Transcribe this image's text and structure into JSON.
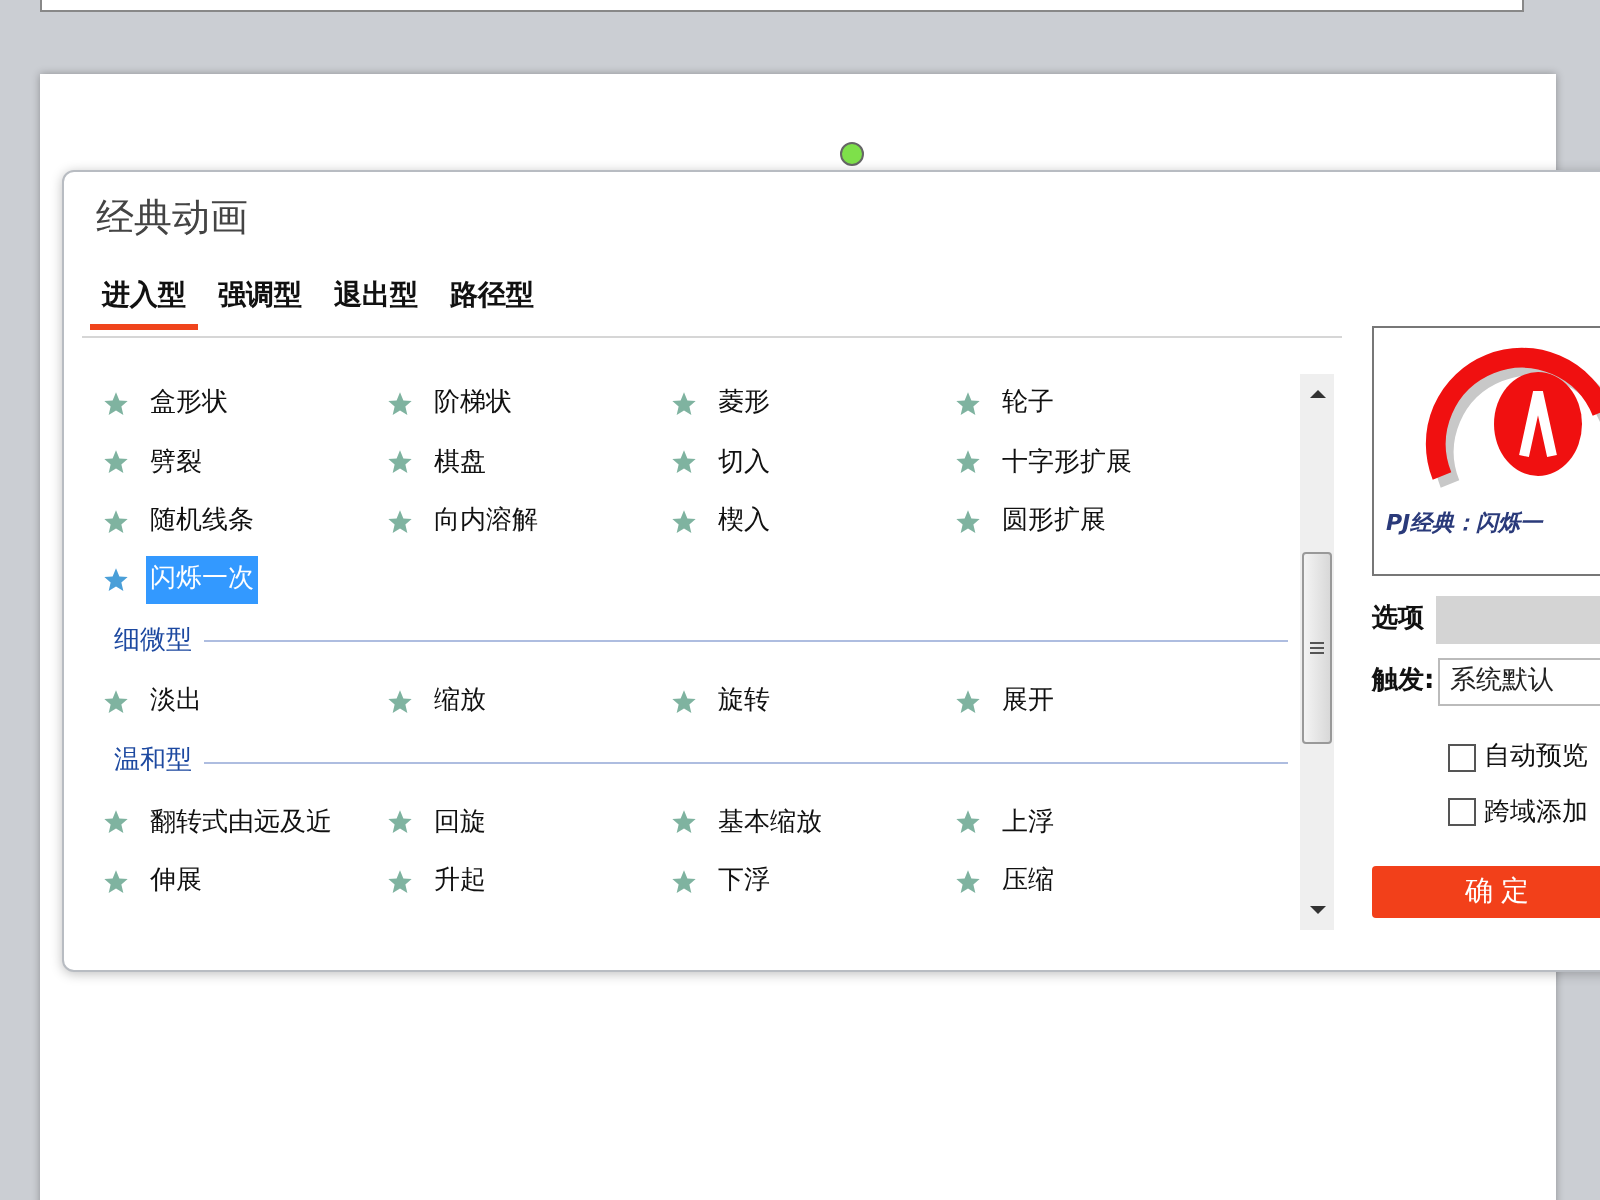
{
  "dialog": {
    "title": "经典动画",
    "tabs": [
      {
        "label": "进入型",
        "selected": true
      },
      {
        "label": "强调型",
        "selected": false
      },
      {
        "label": "退出型",
        "selected": false
      },
      {
        "label": "路径型",
        "selected": false
      }
    ],
    "sections": [
      {
        "items": [
          {
            "label": "盒形状",
            "selected": false
          },
          {
            "label": "阶梯状",
            "selected": false
          },
          {
            "label": "菱形",
            "selected": false
          },
          {
            "label": "轮子",
            "selected": false
          },
          {
            "label": "劈裂",
            "selected": false
          },
          {
            "label": "棋盘",
            "selected": false
          },
          {
            "label": "切入",
            "selected": false
          },
          {
            "label": "十字形扩展",
            "selected": false
          },
          {
            "label": "随机线条",
            "selected": false
          },
          {
            "label": "向内溶解",
            "selected": false
          },
          {
            "label": "楔入",
            "selected": false
          },
          {
            "label": "圆形扩展",
            "selected": false
          },
          {
            "label": "闪烁一次",
            "selected": true
          }
        ]
      },
      {
        "heading": "细微型",
        "items": [
          {
            "label": "淡出",
            "selected": false
          },
          {
            "label": "缩放",
            "selected": false
          },
          {
            "label": "旋转",
            "selected": false
          },
          {
            "label": "展开",
            "selected": false
          }
        ]
      },
      {
        "heading": "温和型",
        "items": [
          {
            "label": "翻转式由远及近",
            "selected": false
          },
          {
            "label": "回旋",
            "selected": false
          },
          {
            "label": "基本缩放",
            "selected": false
          },
          {
            "label": "上浮",
            "selected": false
          },
          {
            "label": "伸展",
            "selected": false
          },
          {
            "label": "升起",
            "selected": false
          },
          {
            "label": "下浮",
            "selected": false
          },
          {
            "label": "压缩",
            "selected": false
          }
        ]
      }
    ],
    "preview": {
      "caption": "PJ经典：闪烁一"
    },
    "options": {
      "label": "选项"
    },
    "trigger": {
      "label": "触发:",
      "value": "系统默认"
    },
    "checkboxes": [
      {
        "label": "自动预览",
        "checked": false
      },
      {
        "label": "跨域添加",
        "checked": false
      }
    ],
    "ok_button": "确 定"
  }
}
